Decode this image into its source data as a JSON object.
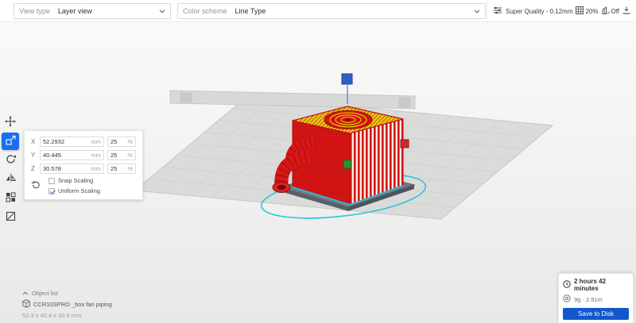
{
  "topbar": {
    "view_type": {
      "label": "View type",
      "value": "Layer view"
    },
    "color_scheme": {
      "label": "Color scheme",
      "value": "Line Type"
    },
    "print_settings": {
      "profile": "Super Quality - 0.12mm",
      "infill": "20%",
      "support": "Off"
    }
  },
  "toolbar": {
    "tools": [
      {
        "id": "move"
      },
      {
        "id": "scale",
        "active": true
      },
      {
        "id": "rotate"
      },
      {
        "id": "mirror"
      },
      {
        "id": "per-model-settings"
      },
      {
        "id": "support-blocker"
      }
    ]
  },
  "scale_panel": {
    "axes": [
      {
        "label": "X",
        "value": "52.2932",
        "unit": "mm",
        "percent": "25",
        "percent_unit": "%"
      },
      {
        "label": "Y",
        "value": "40.445",
        "unit": "mm",
        "percent": "25",
        "percent_unit": "%"
      },
      {
        "label": "Z",
        "value": "30.578",
        "unit": "mm",
        "percent": "25",
        "percent_unit": "%"
      }
    ],
    "snap_label": "Snap Scaling",
    "uniform_label": "Uniform Scaling",
    "snap_checked": false,
    "uniform_checked": true
  },
  "object_list": {
    "title": "Object list",
    "item_name": "CCR10SPRO _box fan piping",
    "selected_dimensions": "52.3 x 40.4 x 30.6 mm"
  },
  "action_panel": {
    "print_time": "2 hours 42 minutes",
    "material_usage": "9g · 2.91m",
    "save_button": "Save to Disk"
  },
  "colors": {
    "accent_blue": "#196ef0",
    "model_red": "#d81717",
    "top_infill_yellow": "#ddce07",
    "skirt_cyan": "#27c7d8",
    "handle_x_red": "#c92a2a",
    "handle_y_green": "#2f8f2f",
    "handle_z_blue": "#2d5fc7"
  }
}
